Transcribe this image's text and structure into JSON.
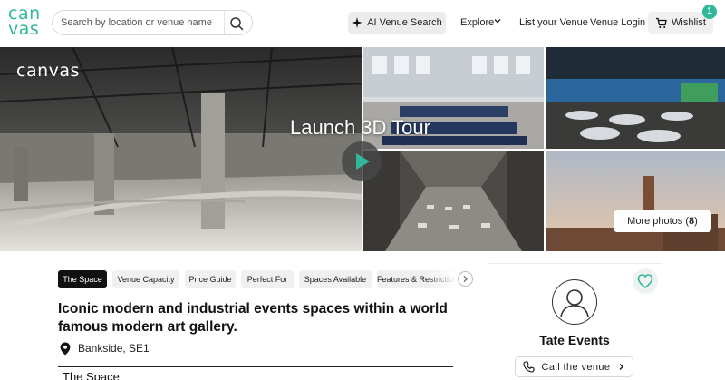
{
  "header": {
    "logo_line1": "can",
    "logo_line2": "vas",
    "search": {
      "placeholder": "Search by location or venue name",
      "value": "",
      "icon": "search-icon"
    },
    "ai_search_label": "AI Venue Search",
    "ai_search_icon": "sparkle-icon",
    "explore_label": "Explore",
    "list_venue_label": "List your Venue",
    "venue_login_label": "Venue Login",
    "wishlist_label": "Wishlist",
    "wishlist_icon": "cart-icon",
    "wishlist_count": "1"
  },
  "gallery": {
    "logo_text": "canvas",
    "tour_label": "Launch 3D Tour",
    "play_icon": "play-icon",
    "more_photos_label": "More photos",
    "more_photos_count": "8"
  },
  "tabs": [
    {
      "label": "The Space",
      "active": true
    },
    {
      "label": "Venue Capacity",
      "active": false
    },
    {
      "label": "Price Guide",
      "active": false
    },
    {
      "label": "Perfect For",
      "active": false
    },
    {
      "label": "Spaces Available",
      "active": false
    },
    {
      "label": "Features & Restrictions",
      "active": false
    }
  ],
  "main": {
    "headline": "Iconic modern and industrial events spaces within a world famous modern art gallery.",
    "location": "Bankside, SE1",
    "section_heading": "The Space"
  },
  "side_card": {
    "venue_name": "Tate Events",
    "call_label": "Call the venue"
  },
  "colors": {
    "brand": "#2fb99a",
    "tour_play": "#2fb99a",
    "active_tab": "#111111"
  }
}
